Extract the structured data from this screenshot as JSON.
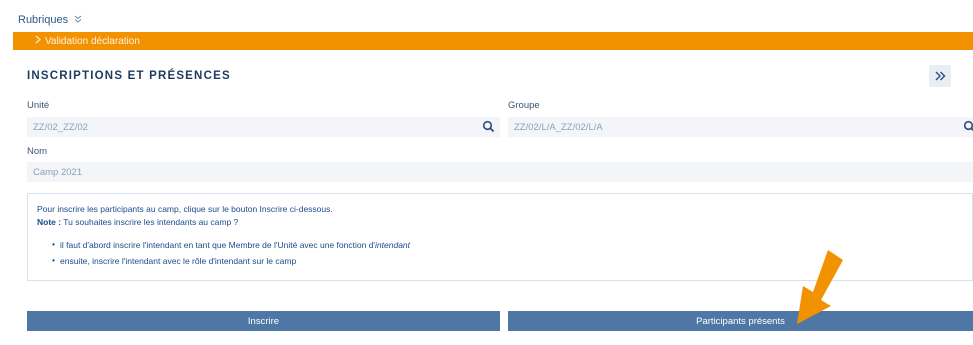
{
  "rubriques": {
    "label": "Rubriques",
    "icon": "double-chevron-down-icon"
  },
  "banner": {
    "label": "Validation déclaration",
    "icon": "chevron-right-icon",
    "color": "#f39200"
  },
  "section": {
    "title": "INSCRIPTIONS ET PRÉSENCES",
    "expand_icon": "double-chevron-right-icon"
  },
  "fields": {
    "unite": {
      "label": "Unité",
      "value": "ZZ/02_ZZ/02",
      "icon": "search-icon"
    },
    "groupe": {
      "label": "Groupe",
      "value": "ZZ/02/L/A_ZZ/02/L/A",
      "icon": "search-icon"
    },
    "nom": {
      "label": "Nom",
      "value": "Camp 2021"
    }
  },
  "info": {
    "line1": "Pour inscrire les participants au camp, clique sur le bouton Inscrire ci-dessous.",
    "note_label": "Note :",
    "note_text": " Tu souhaites inscrire les intendants au camp ?",
    "bullet1_text": "il faut d'abord inscrire l'intendant en tant que Membre de l'Unité avec une fonction d'",
    "bullet1_em": "intendant",
    "bullet2": "ensuite, inscrire l'intendant avec le rôle d'intendant sur le camp"
  },
  "buttons": {
    "inscrire": "Inscrire",
    "participants": "Participants présents"
  },
  "colors": {
    "button": "#4f77a6",
    "arrow": "#f39200",
    "text": "#1f3a5f"
  },
  "overlay": {
    "icon": "orange-pointer-arrow-icon"
  }
}
